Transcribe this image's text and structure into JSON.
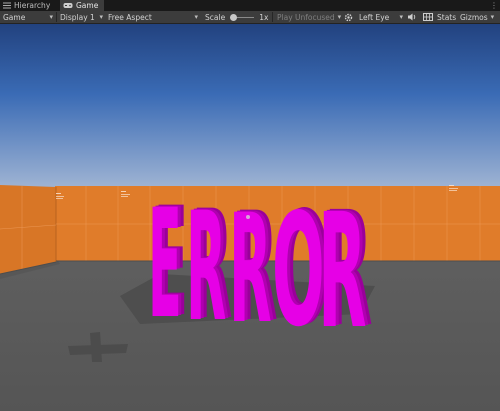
{
  "tabs": {
    "hierarchy": "Hierarchy",
    "game": "Game"
  },
  "toolbar": {
    "view_mode": "Game",
    "display": "Display 1",
    "aspect": "Free Aspect",
    "scale_label": "Scale",
    "scale_value": "1x",
    "play_mode": "Play Unfocused",
    "eye": "Left Eye",
    "stats": "Stats",
    "gizmos": "Gizmos"
  },
  "scene": {
    "error_text": "ERROR",
    "letters": [
      "E",
      "R",
      "R",
      "O",
      "R"
    ]
  },
  "colors": {
    "sky_top": "#2c4f95",
    "sky_horizon": "#bcc8da",
    "wall": "#e07d2c",
    "floor": "#595959",
    "error_magenta": "#e600e6"
  },
  "icons": [
    "hierarchy-list-icon",
    "gamepad-icon",
    "speaker-icon",
    "grid-icon",
    "camera-gear-icon",
    "kebab-menu-icon"
  ]
}
